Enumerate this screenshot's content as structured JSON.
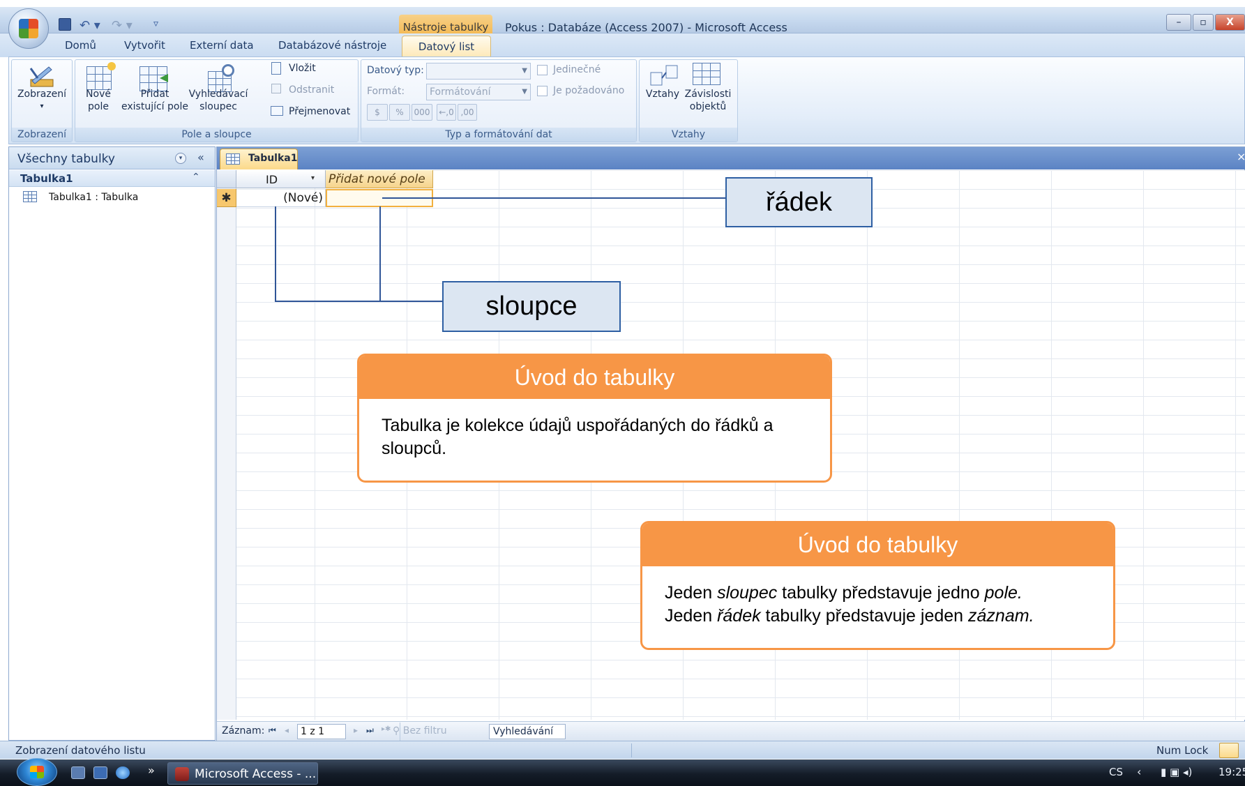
{
  "window": {
    "context_tab": "Nástroje tabulky",
    "title": "Pokus : Databáze (Access 2007) - Microsoft Access",
    "controls": {
      "minimize": "–",
      "maximize": "▫",
      "close": "X"
    }
  },
  "quick_access": {
    "undo": "↶ ▾",
    "redo": "↷ ▾",
    "customize": "▿"
  },
  "ribbon_tabs": [
    "Domů",
    "Vytvořit",
    "Externí data",
    "Databázové nástroje",
    "Datový list"
  ],
  "active_tab": "Datový list",
  "ribbon": {
    "view_group": {
      "label": "Zobrazení",
      "view_button": "Zobrazení",
      "view_arrow": "▾"
    },
    "fields_group": {
      "label": "Pole a sloupce",
      "new_field": "Nové pole",
      "add_existing": "Přidat existující pole",
      "lookup_column": "Vyhledávací sloupec",
      "insert": "Vložit",
      "delete": "Odstranit",
      "rename": "Přejmenovat"
    },
    "datatype_group": {
      "label": "Typ a formátování dat",
      "datatype_label": "Datový typ:",
      "datatype_value": "",
      "format_label": "Formát:",
      "format_value": "Formátování",
      "unique": "Jedinečné",
      "required": "Je požadováno",
      "fmt_buttons": [
        "$",
        "%",
        "000",
        "←,0",
        ",00"
      ]
    },
    "relationships_group": {
      "label": "Vztahy",
      "relationships": "Vztahy",
      "dependencies": "Závislosti objektů"
    }
  },
  "nav_pane": {
    "title": "Všechny tabulky",
    "dropdown_glyph": "▾",
    "collapse_glyph": "«",
    "group": "Tabulka1",
    "group_glyph": "⌃",
    "item": "Tabulka1 : Tabulka"
  },
  "document": {
    "tab": "Tabulka1",
    "close_glyph": "×",
    "columns": [
      "ID",
      "Přidat nové pole"
    ],
    "id_arrow": "▾",
    "new_row_marker": "✱",
    "new_row_id": "(Nové)"
  },
  "record_nav": {
    "label": "Záznam:",
    "first": "⏮",
    "prev": "◂",
    "position": "1 z 1",
    "next": "▸",
    "last": "⏭",
    "new": "▸✱",
    "filter": "Bez filtru",
    "search": "Vyhledávání"
  },
  "status_bar": {
    "left": "Zobrazení datového listu",
    "numlock": "Num Lock"
  },
  "taskbar": {
    "expand": "»",
    "task": "Microsoft Access - ...",
    "lang": "CS",
    "tray_arrow": "‹",
    "clock": "19:25"
  },
  "annotations": {
    "row_label": "řádek",
    "columns_label": "sloupce",
    "box1": {
      "title": "Úvod do tabulky",
      "body": "Tabulka je kolekce údajů uspořádaných do řádků a sloupců."
    },
    "box2": {
      "title": "Úvod do tabulky",
      "line1_a": "Jeden ",
      "line1_em1": "sloupec",
      "line1_b": " tabulky představuje jedno ",
      "line1_em2": "pole.",
      "line2_a": "Jeden ",
      "line2_em1": "řádek",
      "line2_b": " tabulky představuje jeden ",
      "line2_em2": "záznam."
    }
  },
  "colors": {
    "callout_orange": "#f79646",
    "ribbon_blue": "#c5d8ee",
    "tab_gold": "#fbd98a",
    "label_fill": "#dce6f2",
    "label_border": "#2e5fa3"
  }
}
